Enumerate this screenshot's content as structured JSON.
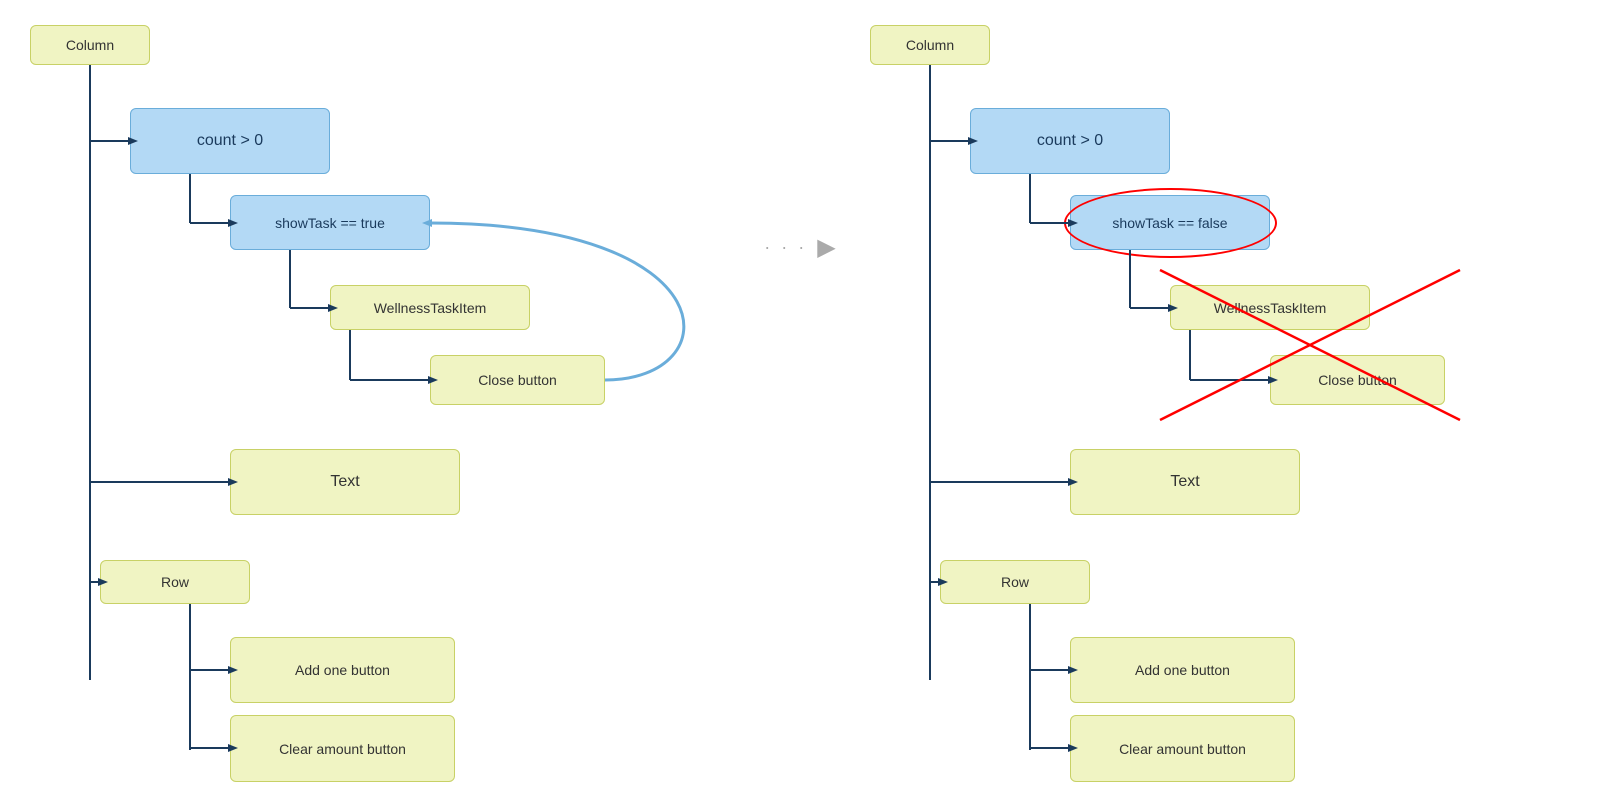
{
  "left": {
    "column_label": "Column",
    "count_label": "count > 0",
    "showTask_label": "showTask == true",
    "wellnessTask_label": "WellnessTaskItem",
    "closeButton_label": "Close button",
    "text_label": "Text",
    "row_label": "Row",
    "addOne_label": "Add one button",
    "clearAmount_label": "Clear amount button"
  },
  "right": {
    "column_label": "Column",
    "count_label": "count > 0",
    "showTask_label": "showTask == false",
    "wellnessTask_label": "WellnessTaskItem",
    "closeButton_label": "Close button",
    "text_label": "Text",
    "row_label": "Row",
    "addOne_label": "Add one button",
    "clearAmount_label": "Clear amount button"
  },
  "divider": {
    "dots": "· · ·",
    "arrow": "▶"
  }
}
